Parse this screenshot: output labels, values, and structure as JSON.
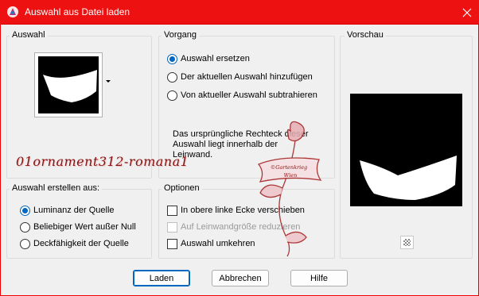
{
  "window": {
    "title": "Auswahl aus Datei laden"
  },
  "groups": {
    "auswahl": {
      "label": "Auswahl"
    },
    "vorgang": {
      "label": "Vorgang",
      "options": [
        {
          "label": "Auswahl ersetzen",
          "checked": true
        },
        {
          "label": "Der aktuellen Auswahl hinzufügen",
          "checked": false
        },
        {
          "label": "Von aktueller Auswahl subtrahieren",
          "checked": false
        }
      ],
      "info": "Das ursprüngliche Rechteck dieser Auswahl liegt innerhalb der Leinwand."
    },
    "vorschau": {
      "label": "Vorschau"
    },
    "erstellen": {
      "label": "Auswahl erstellen aus:",
      "options": [
        {
          "label": "Luminanz der Quelle",
          "checked": true
        },
        {
          "label": "Beliebiger Wert außer Null",
          "checked": false
        },
        {
          "label": "Deckfähigkeit der Quelle",
          "checked": false
        }
      ]
    },
    "optionen": {
      "label": "Optionen",
      "checks": [
        {
          "label": "In obere linke Ecke verschieben",
          "checked": false,
          "disabled": false
        },
        {
          "label": "Auf Leinwandgröße reduzieren",
          "checked": false,
          "disabled": true
        },
        {
          "label": "Auswahl umkehren",
          "checked": false,
          "disabled": false
        }
      ]
    }
  },
  "buttons": {
    "load": "Laden",
    "cancel": "Abbrechen",
    "help": "Hilfe"
  },
  "watermark": {
    "filename": "01ornament312-romana1",
    "seal_line1": "©Gartenkrieg",
    "seal_line2": "Wien"
  },
  "colors": {
    "titlebar": "#ee1111",
    "accent": "#0067c0",
    "watermark": "#8a1010"
  }
}
